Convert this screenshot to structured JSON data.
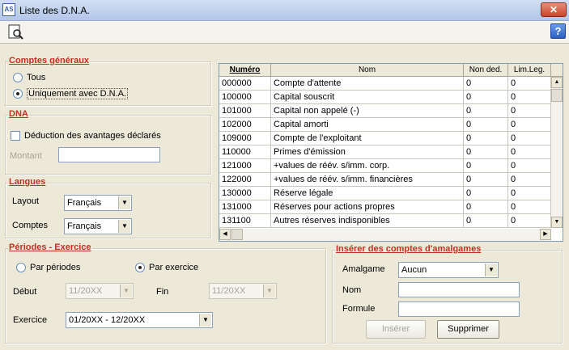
{
  "window": {
    "title": "Liste des D.N.A.",
    "app_icon_text": "AS",
    "close_glyph": "✕"
  },
  "toolbar": {
    "help_glyph": "?"
  },
  "comptes_generaux": {
    "legend": "Comptes généraux",
    "options": [
      "Tous",
      "Uniquement avec D.N.A."
    ],
    "selected_index": 1
  },
  "dna": {
    "legend": "DNA",
    "checkbox_label": "Déduction des avantages déclarés",
    "montant_label": "Montant",
    "montant_value": ""
  },
  "langues": {
    "legend": "Langues",
    "layout_label": "Layout",
    "layout_value": "Français",
    "comptes_label": "Comptes",
    "comptes_value": "Français"
  },
  "periodes": {
    "legend": "Périodes - Exercice",
    "options": [
      "Par périodes",
      "Par exercice"
    ],
    "selected_index": 1,
    "debut_label": "Début",
    "debut_value": "11/20XX",
    "fin_label": "Fin",
    "fin_value": "11/20XX",
    "exercice_label": "Exercice",
    "exercice_value": "01/20XX - 12/20XX"
  },
  "amalgames": {
    "legend": "Insérer des comptes d'amalgames",
    "amalgame_label": "Amalgame",
    "amalgame_value": "Aucun",
    "nom_label": "Nom",
    "nom_value": "",
    "formule_label": "Formule",
    "formule_value": "",
    "inserer_button": "Insérer",
    "supprimer_button": "Supprimer"
  },
  "table": {
    "columns": [
      "Numéro",
      "Nom",
      "Non ded.",
      "Lim.Leg."
    ],
    "rows": [
      [
        "000000",
        "Compte d'attente",
        "0",
        "0"
      ],
      [
        "100000",
        "Capital souscrit",
        "0",
        "0"
      ],
      [
        "101000",
        "Capital non appelé (-)",
        "0",
        "0"
      ],
      [
        "102000",
        "Capital amorti",
        "0",
        "0"
      ],
      [
        "109000",
        "Compte de l'exploitant",
        "0",
        "0"
      ],
      [
        "110000",
        "Primes d'émission",
        "0",
        "0"
      ],
      [
        "121000",
        "+values de réév. s/imm. corp.",
        "0",
        "0"
      ],
      [
        "122000",
        "+values de réév. s/imm. financières",
        "0",
        "0"
      ],
      [
        "130000",
        "Réserve légale",
        "0",
        "0"
      ],
      [
        "131000",
        "Réserves pour actions propres",
        "0",
        "0"
      ],
      [
        "131100",
        "Autres réserves indisponibles",
        "0",
        "0"
      ]
    ]
  }
}
